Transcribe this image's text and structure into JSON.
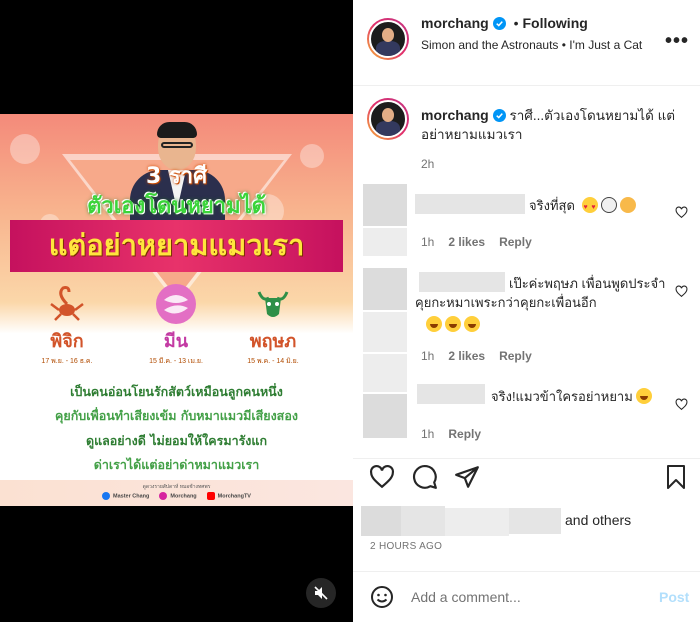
{
  "post": {
    "media": {
      "headline_1": "3 ราศี",
      "headline_2": "ตัวเองโดนหยามได้",
      "headline_3": "แต่อย่าหยามแมวเรา",
      "signs": [
        {
          "name": "พิจิก",
          "dates": "17 พ.ย. - 16 ธ.ค.",
          "color": "#d2542a"
        },
        {
          "name": "มีน",
          "dates": "15 มี.ค. - 13 เม.ย.",
          "color": "#c33aa3"
        },
        {
          "name": "พฤษภ",
          "dates": "15 พ.ค. - 14 มิ.ย.",
          "color": "#2e9048"
        }
      ],
      "lines": [
        "เป็นคนอ่อนโยนรักสัตว์เหมือนลูกคนหนึ่ง",
        "คุยกับเพื่อนทำเสียงเข้ม กับหมาแมวมีเสียงสอง",
        "ดูแลอย่างดี ไม่ยอมให้ใครมารังแก",
        "ด่าเราได้แต่อย่าด่าหมาแมวเรา"
      ],
      "credit_top": "ดูดวงรายสัปดาห์ หมอช้างทศพร",
      "credits": [
        "Master Chang",
        "Morchang",
        "MorchangTV"
      ],
      "mute_icon": "speaker-muted-icon"
    },
    "header": {
      "username": "morchang",
      "separator": "•",
      "follow_status": "Following",
      "audio": "Simon and the Astronauts • I'm Just a Cat",
      "more_label": "•••"
    },
    "caption": {
      "username": "morchang",
      "text": "ราศี...ตัวเองโดนหยามได้ แต่อย่าหยามแมวเรา",
      "time": "2h"
    },
    "comments": [
      {
        "text": "จริงที่สุด",
        "time": "1h",
        "likes": "2 likes",
        "reply": "Reply"
      },
      {
        "text": "เป๊ะค่ะพฤษภ เพื่อนพูดประจำ คุยกะหมาเพระกว่าคุยกะเพื่อนอีก",
        "time": "1h",
        "likes": "2 likes",
        "reply": "Reply"
      },
      {
        "text": "จริง!แมวข้าใครอย่าหยาม",
        "time": "1h",
        "reply": "Reply"
      }
    ],
    "likes_text": "and others",
    "posted_ago": "2 HOURS AGO",
    "add_comment": {
      "placeholder": "Add a comment...",
      "post_label": "Post"
    }
  },
  "colors": {
    "verified": "#0095f6",
    "post_button": "#b2dffc",
    "muted_text": "#737373"
  }
}
